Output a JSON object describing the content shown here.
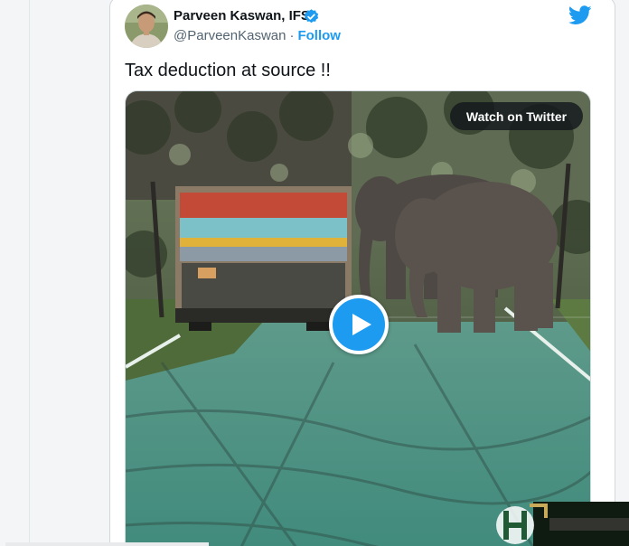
{
  "tweet": {
    "author_name": "Parveen Kaswan, IFS",
    "handle": "@ParveenKaswan",
    "separator": "·",
    "follow_label": "Follow",
    "text": "Tax deduction at source !!",
    "verified": true
  },
  "media": {
    "watch_label": "Watch on Twitter",
    "play_icon": "play-icon"
  },
  "icons": {
    "brand": "twitter-bird-icon",
    "verified": "verified-badge-icon"
  },
  "colors": {
    "accent": "#1d9bf0",
    "text": "#0f1419",
    "secondary_text": "#536471",
    "border": "#cfd9de"
  }
}
